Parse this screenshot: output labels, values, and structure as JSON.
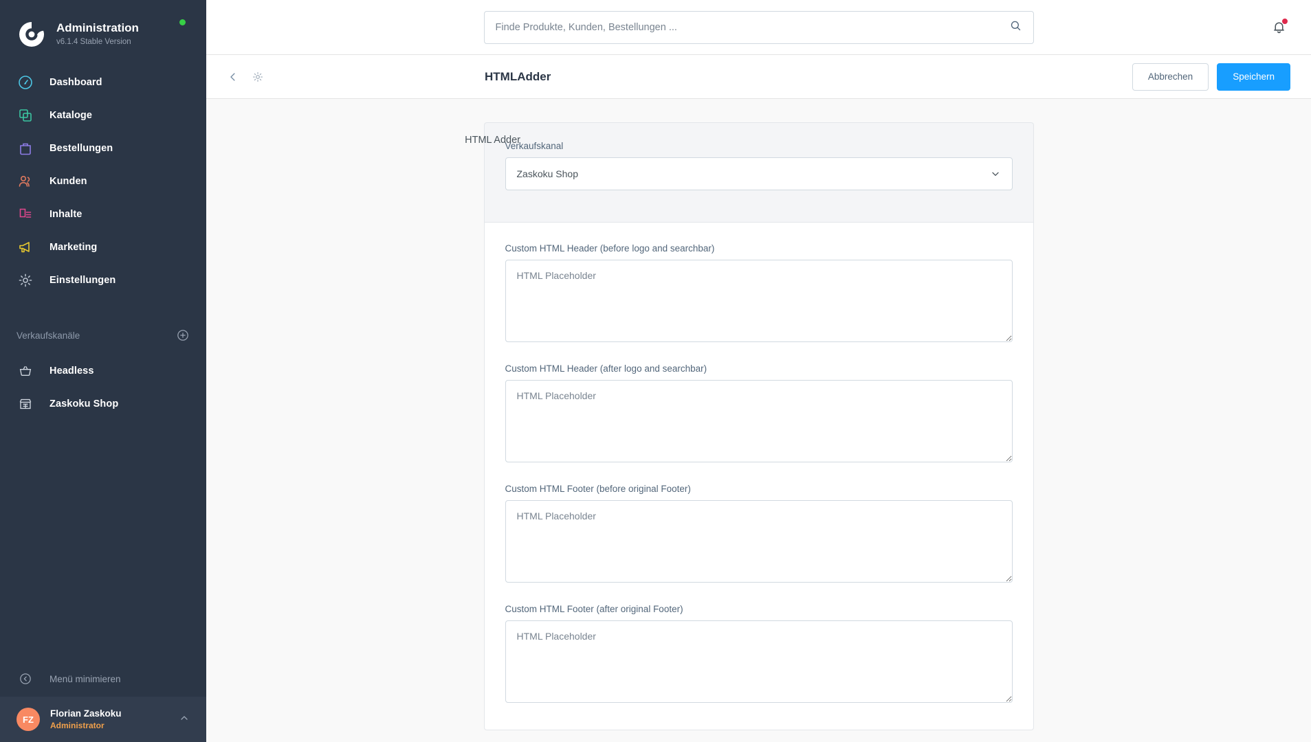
{
  "sidebar": {
    "brand": {
      "title": "Administration",
      "version": "v6.1.4 Stable Version",
      "logo_icon": "shopware-logo-icon",
      "status_dot_color": "#37d046"
    },
    "nav_items": [
      {
        "label": "Dashboard",
        "icon": "dashboard-icon",
        "color": "#4dc6e4"
      },
      {
        "label": "Kataloge",
        "icon": "catalog-icon",
        "color": "#3bc5a1"
      },
      {
        "label": "Bestellungen",
        "icon": "orders-bag-icon",
        "color": "#8d7ce6"
      },
      {
        "label": "Kunden",
        "icon": "customers-icon",
        "color": "#e07a5f"
      },
      {
        "label": "Inhalte",
        "icon": "content-icon",
        "color": "#e0478c"
      },
      {
        "label": "Marketing",
        "icon": "megaphone-icon",
        "color": "#e8c92f"
      },
      {
        "label": "Einstellungen",
        "icon": "gear-icon",
        "color": "#b6bfcb"
      }
    ],
    "sales_channels": {
      "section_title": "Verkaufskanäle",
      "add_icon": "plus-circle-icon",
      "items": [
        {
          "label": "Headless",
          "icon": "basket-icon"
        },
        {
          "label": "Zaskoku Shop",
          "icon": "storefront-icon"
        }
      ]
    },
    "minimize": {
      "label": "Menü minimieren",
      "icon": "collapse-left-icon"
    },
    "user": {
      "initials": "FZ",
      "name": "Florian Zaskoku",
      "role": "Administrator",
      "caret_icon": "chevron-up-icon",
      "avatar_color": "#f88962"
    }
  },
  "topbar": {
    "search": {
      "placeholder": "Finde Produkte, Kunden, Bestellungen ...",
      "value": "",
      "icon": "search-icon"
    },
    "notifications": {
      "icon": "bell-icon",
      "has_badge": true,
      "badge_color": "#de294c"
    }
  },
  "smart_bar": {
    "back_icon": "chevron-left-icon",
    "settings_icon": "gear-icon",
    "title": "HTMLAdder",
    "cancel_label": "Abbrechen",
    "save_label": "Speichern",
    "primary_color": "#189eff"
  },
  "main": {
    "card_label": "HTML Adder",
    "sales_channel_field": {
      "label": "Verkaufskanal",
      "value": "Zaskoku Shop",
      "caret_icon": "chevron-down-icon"
    },
    "html_fields": [
      {
        "label": "Custom HTML Header (before logo and searchbar)",
        "placeholder": "HTML Placeholder",
        "value": ""
      },
      {
        "label": "Custom HTML Header (after logo and searchbar)",
        "placeholder": "HTML Placeholder",
        "value": ""
      },
      {
        "label": "Custom HTML Footer (before original Footer)",
        "placeholder": "HTML Placeholder",
        "value": ""
      },
      {
        "label": "Custom HTML Footer (after original Footer)",
        "placeholder": "HTML Placeholder",
        "value": ""
      }
    ]
  }
}
